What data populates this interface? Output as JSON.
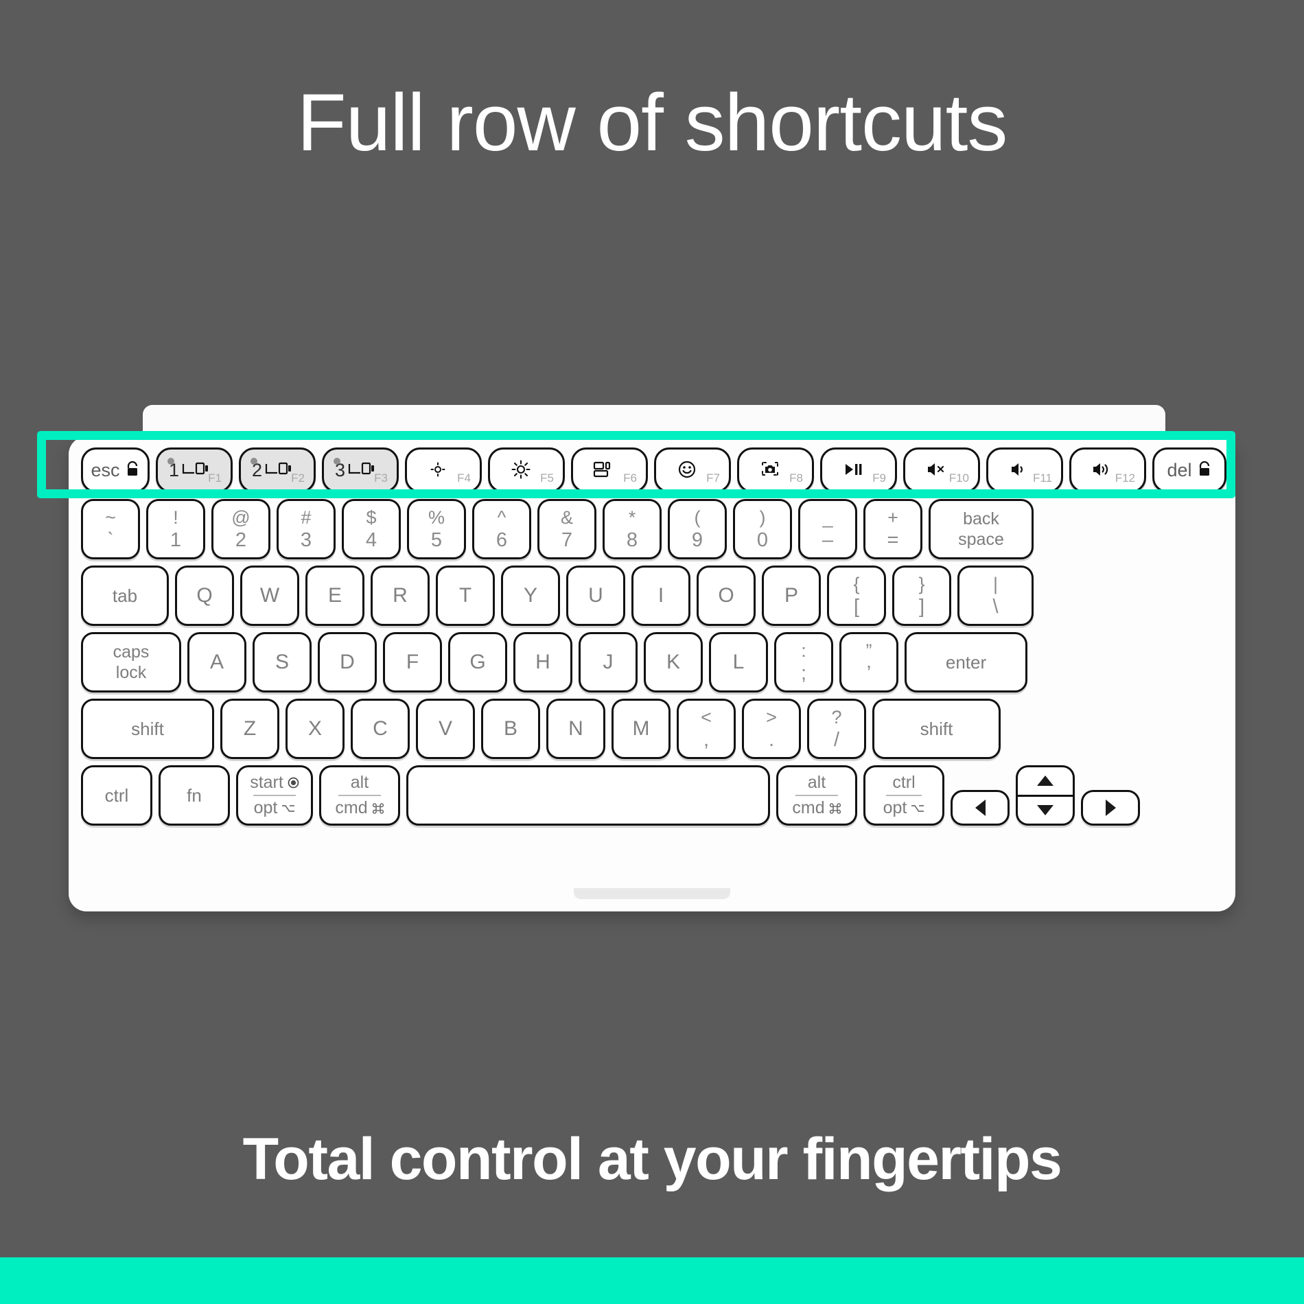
{
  "headline": "Full row of shortcuts",
  "caption": "Total control at your fingertips",
  "colors": {
    "background": "#5b5b5b",
    "accent": "#00efc0",
    "keyboard_body": "#fdfdfd",
    "key_face": "#ffffff",
    "key_shaded": "#e3e3e3",
    "legend": "#7d7d7d"
  },
  "highlight": {
    "target": "function-row",
    "border_color": "#00efc0"
  },
  "keyboard": {
    "fn_row": [
      {
        "name": "esc",
        "label": "esc",
        "icon": "lock-icon",
        "fn": "",
        "shaded": false
      },
      {
        "name": "easy-switch-1",
        "label": "1",
        "icon": "device-switch-icon",
        "fn": "F1",
        "shaded": true,
        "led": true
      },
      {
        "name": "easy-switch-2",
        "label": "2",
        "icon": "device-switch-icon",
        "fn": "F2",
        "shaded": true,
        "led": true
      },
      {
        "name": "easy-switch-3",
        "label": "3",
        "icon": "device-switch-icon",
        "fn": "F3",
        "shaded": true,
        "led": true
      },
      {
        "name": "brightness-down",
        "label": "",
        "icon": "brightness-down-icon",
        "fn": "F4",
        "shaded": false
      },
      {
        "name": "brightness-up",
        "label": "",
        "icon": "brightness-up-icon",
        "fn": "F5",
        "shaded": false
      },
      {
        "name": "task-view",
        "label": "",
        "icon": "window-switcher-icon",
        "fn": "F6",
        "shaded": false
      },
      {
        "name": "emoji",
        "label": "",
        "icon": "emoji-smiley-icon",
        "fn": "F7",
        "shaded": false
      },
      {
        "name": "screenshot",
        "label": "",
        "icon": "screenshot-camera-icon",
        "fn": "F8",
        "shaded": false
      },
      {
        "name": "play-pause",
        "label": "",
        "icon": "play-pause-icon",
        "fn": "F9",
        "shaded": false
      },
      {
        "name": "mute",
        "label": "",
        "icon": "volume-mute-icon",
        "fn": "F10",
        "shaded": false
      },
      {
        "name": "volume-down",
        "label": "",
        "icon": "volume-down-icon",
        "fn": "F11",
        "shaded": false
      },
      {
        "name": "volume-up",
        "label": "",
        "icon": "volume-up-icon",
        "fn": "F12",
        "shaded": false
      },
      {
        "name": "del",
        "label": "del",
        "icon": "lock-icon",
        "fn": "",
        "shaded": false
      }
    ],
    "number_row": [
      {
        "name": "backtick",
        "top": "~",
        "bottom": "`"
      },
      {
        "name": "one",
        "top": "!",
        "bottom": "1"
      },
      {
        "name": "two",
        "top": "@",
        "bottom": "2"
      },
      {
        "name": "three",
        "top": "#",
        "bottom": "3"
      },
      {
        "name": "four",
        "top": "$",
        "bottom": "4"
      },
      {
        "name": "five",
        "top": "%",
        "bottom": "5"
      },
      {
        "name": "six",
        "top": "^",
        "bottom": "6"
      },
      {
        "name": "seven",
        "top": "&",
        "bottom": "7"
      },
      {
        "name": "eight",
        "top": "*",
        "bottom": "8"
      },
      {
        "name": "nine",
        "top": "(",
        "bottom": "9"
      },
      {
        "name": "zero",
        "top": ")",
        "bottom": "0"
      },
      {
        "name": "minus",
        "top": "_",
        "bottom": "–"
      },
      {
        "name": "equals",
        "top": "+",
        "bottom": "="
      }
    ],
    "backspace": {
      "name": "backspace",
      "line1": "back",
      "line2": "space"
    },
    "tab_row": {
      "tab": "tab",
      "letters": [
        "Q",
        "W",
        "E",
        "R",
        "T",
        "Y",
        "U",
        "I",
        "O",
        "P"
      ],
      "bracket_left": {
        "top": "{",
        "bottom": "["
      },
      "bracket_right": {
        "top": "}",
        "bottom": "]"
      },
      "backslash": {
        "top": "|",
        "bottom": "\\"
      }
    },
    "home_row": {
      "caps": {
        "line1": "caps",
        "line2": "lock"
      },
      "letters": [
        "A",
        "S",
        "D",
        "F",
        "G",
        "H",
        "J",
        "K",
        "L"
      ],
      "semicolon": {
        "top": ":",
        "bottom": ";"
      },
      "quote": {
        "top": "”",
        "bottom": "’"
      },
      "enter": "enter"
    },
    "shift_row": {
      "shift_left": "shift",
      "letters": [
        "Z",
        "X",
        "C",
        "V",
        "B",
        "N",
        "M"
      ],
      "comma": {
        "top": "<",
        "bottom": ","
      },
      "period": {
        "top": ">",
        "bottom": "."
      },
      "slash": {
        "top": "?",
        "bottom": "/"
      },
      "shift_right": "shift"
    },
    "bottom_row": {
      "ctrl": "ctrl",
      "fn": "fn",
      "start_opt": {
        "upper": "start",
        "upper_icon": "windows-start-icon",
        "lower": "opt",
        "lower_icon": "option-icon"
      },
      "alt_cmd": {
        "upper": "alt",
        "lower": "cmd",
        "lower_icon": "command-icon"
      },
      "space": "",
      "alt_cmd_right": {
        "upper": "alt",
        "lower": "cmd",
        "lower_icon": "command-icon"
      },
      "ctrl_opt_right": {
        "upper": "ctrl",
        "lower": "opt",
        "lower_icon": "option-icon"
      },
      "arrows": {
        "left": "left-arrow-icon",
        "up": "up-arrow-icon",
        "down": "down-arrow-icon",
        "right": "right-arrow-icon"
      }
    }
  }
}
